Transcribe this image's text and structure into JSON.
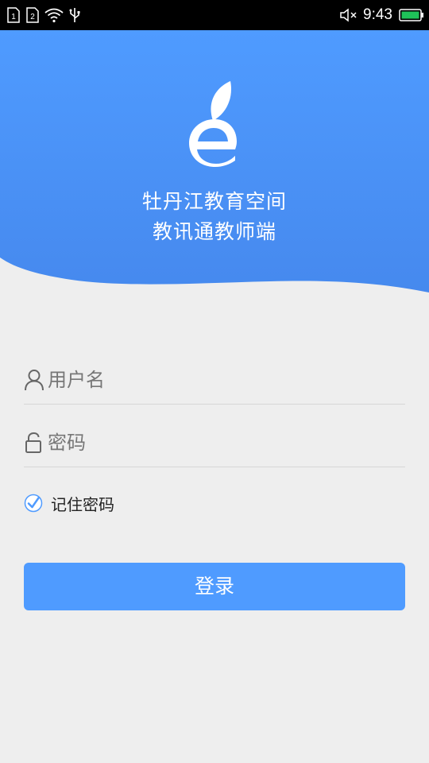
{
  "status_bar": {
    "sim1": "1",
    "sim2": "2",
    "time": "9:43",
    "icons": [
      "sim1-icon",
      "sim2-icon",
      "wifi-icon",
      "usb-icon",
      "mute-icon",
      "battery-icon"
    ]
  },
  "header": {
    "logo": "e-logo-icon",
    "title": "牡丹江教育空间",
    "subtitle": "教讯通教师端",
    "gradient_top": "#4f9bff",
    "gradient_bottom": "#4a8df0"
  },
  "form": {
    "username_placeholder": "用户名",
    "username_value": "",
    "password_placeholder": "密码",
    "password_value": "",
    "remember_label": "记住密码",
    "remember_checked": true
  },
  "login_button": {
    "label": "登录",
    "color": "#4f9bff"
  }
}
